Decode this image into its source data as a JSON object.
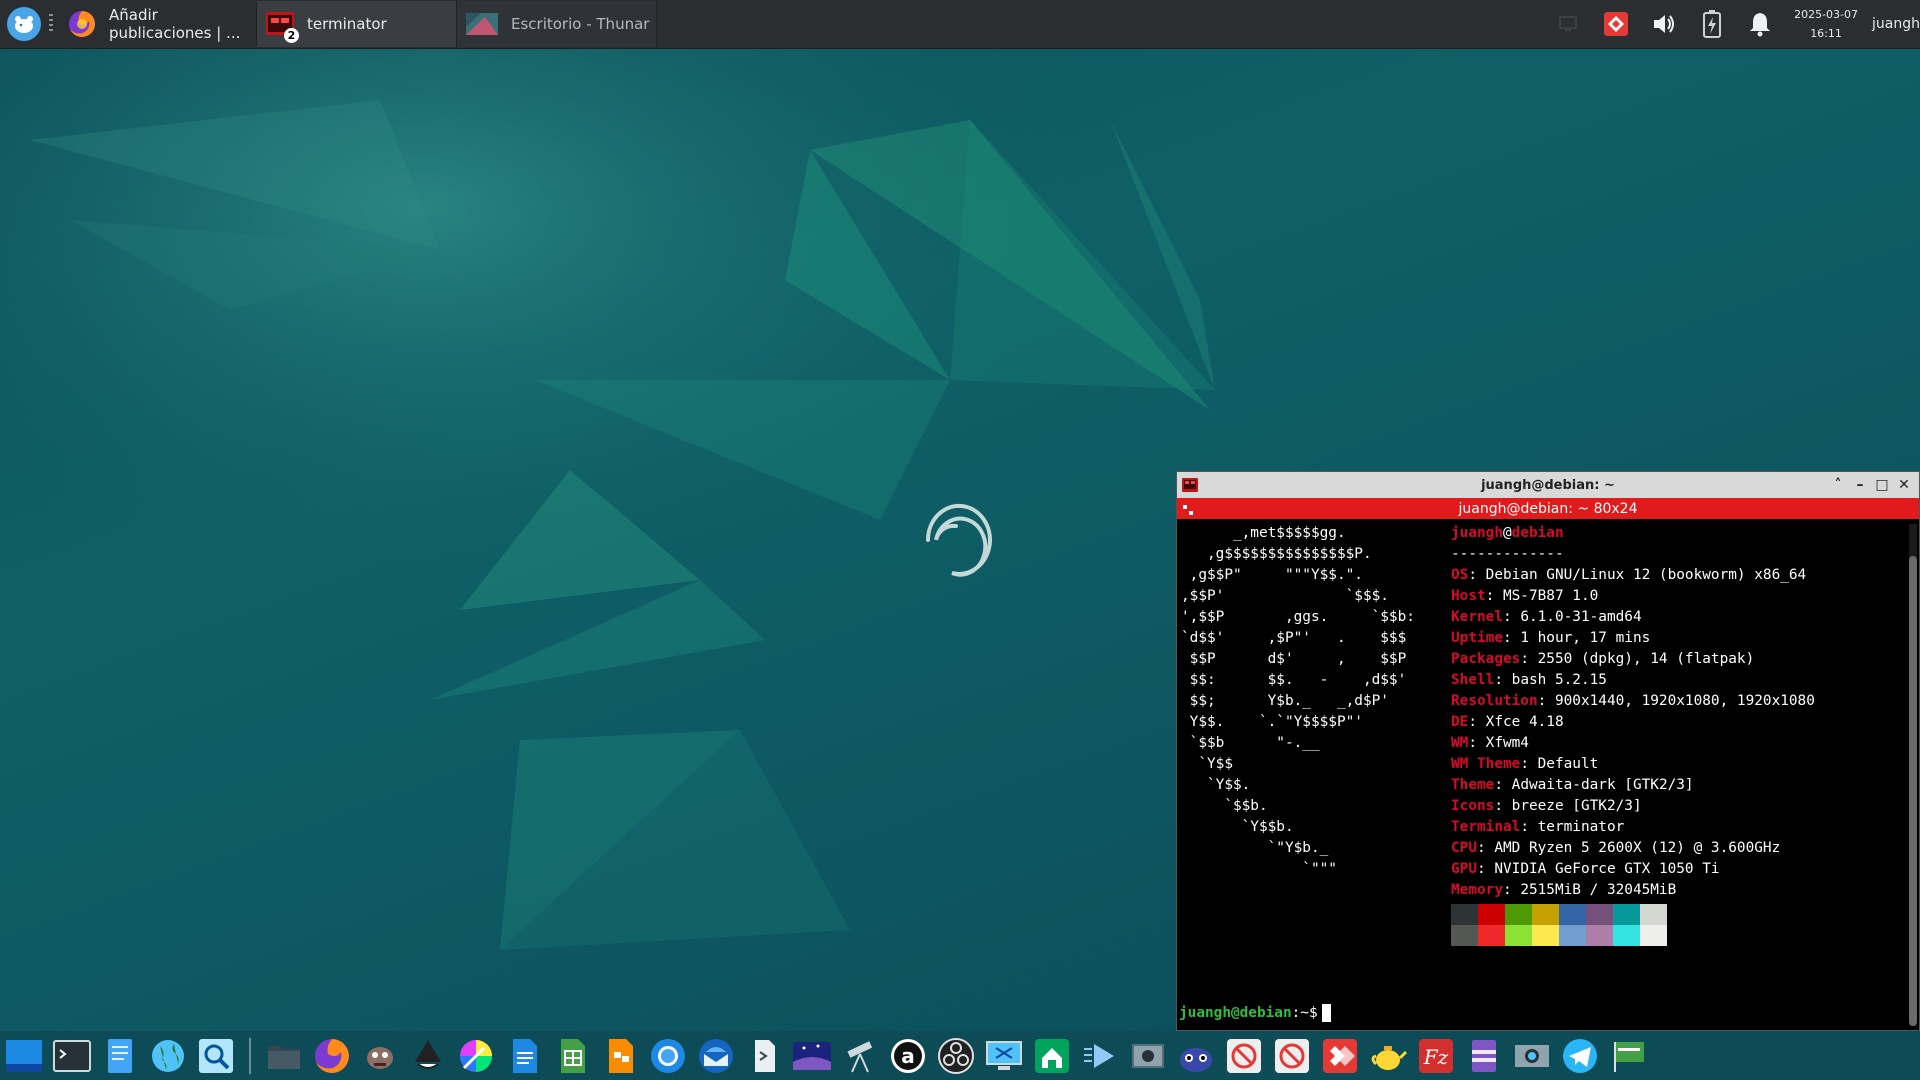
{
  "top_panel": {
    "tasks": [
      {
        "label": "Añadir publicaciones | ...",
        "icon": "firefox-icon",
        "state": "normal"
      },
      {
        "label": "terminator",
        "icon": "terminator-icon",
        "state": "active",
        "badge": "2"
      },
      {
        "label": "Escritorio - Thunar",
        "icon": "thunar-icon",
        "state": "inactive"
      }
    ],
    "clock": {
      "date": "2025-03-07",
      "time": "16:11"
    },
    "user": "juangh"
  },
  "terminal": {
    "window_title": "juangh@debian: ~",
    "tab_title": "juangh@debian: ~ 80x24",
    "logo_lines": [
      "      _,met$$$$$gg.",
      "   ,g$$$$$$$$$$$$$$$P.",
      " ,g$$P\"     \"\"\"Y$$.\".",
      ",$$P'              `$$$.",
      "',$$P       ,ggs.     `$$b:",
      "`d$$'     ,$P\"'   .    $$$",
      " $$P      d$'     ,    $$P",
      " $$:      $$.   -    ,d$$'",
      " $$;      Y$b._   _,d$P'",
      " Y$$.    `.`\"Y$$$$P\"'",
      " `$$b      \"-.__",
      "  `Y$$",
      "   `Y$$.",
      "     `$$b.",
      "       `Y$$b.",
      "          `\"Y$b._",
      "              `\"\"\""
    ],
    "header": {
      "user": "juangh",
      "at": "@",
      "host": "debian",
      "rule": "-------------"
    },
    "info": [
      {
        "key": "OS",
        "value": "Debian GNU/Linux 12 (bookworm) x86_64"
      },
      {
        "key": "Host",
        "value": "MS-7B87 1.0"
      },
      {
        "key": "Kernel",
        "value": "6.1.0-31-amd64"
      },
      {
        "key": "Uptime",
        "value": "1 hour, 17 mins"
      },
      {
        "key": "Packages",
        "value": "2550 (dpkg), 14 (flatpak)"
      },
      {
        "key": "Shell",
        "value": "bash 5.2.15"
      },
      {
        "key": "Resolution",
        "value": "900x1440, 1920x1080, 1920x1080"
      },
      {
        "key": "DE",
        "value": "Xfce 4.18"
      },
      {
        "key": "WM",
        "value": "Xfwm4"
      },
      {
        "key": "WM Theme",
        "value": "Default"
      },
      {
        "key": "Theme",
        "value": "Adwaita-dark [GTK2/3]"
      },
      {
        "key": "Icons",
        "value": "breeze [GTK2/3]"
      },
      {
        "key": "Terminal",
        "value": "terminator"
      },
      {
        "key": "CPU",
        "value": "AMD Ryzen 5 2600X (12) @ 3.600GHz"
      },
      {
        "key": "GPU",
        "value": "NVIDIA GeForce GTX 1050 Ti"
      },
      {
        "key": "Memory",
        "value": "2515MiB / 32045MiB"
      }
    ],
    "palette": [
      "#2e3436",
      "#cc0000",
      "#4e9a06",
      "#c4a000",
      "#3465a4",
      "#75507b",
      "#06989a",
      "#d3d7cf",
      "#555753",
      "#ef2929",
      "#8ae234",
      "#fce94f",
      "#729fcf",
      "#ad7fa8",
      "#34e2e2",
      "#eeeeec"
    ],
    "prompt": {
      "user_host": "juangh@debian",
      "rest": ":~$"
    }
  },
  "dock": {
    "items": [
      "show-desktop-icon",
      "terminal-icon",
      "text-editor-icon",
      "web-browser-icon",
      "app-finder-icon",
      "separator",
      "file-manager-icon",
      "firefox-icon",
      "gimp-icon",
      "inkscape-icon",
      "color-picker-icon",
      "writer-icon",
      "calc-icon",
      "impress-icon",
      "chromium-icon",
      "thunderbird-icon",
      "script-icon",
      "stellarium-icon",
      "telescope-icon",
      "audacity-icon",
      "obs-icon",
      "remote-desktop-icon",
      "house-icon",
      "media-player-icon",
      "video-editor-icon",
      "game-icon",
      "blocked-app-icon",
      "blocked-app-icon",
      "anydesk-icon",
      "teapot-icon",
      "filezilla-icon",
      "archive-icon",
      "screenshot-icon",
      "telegram-icon",
      "flag-app-icon"
    ]
  },
  "colors": {
    "panel": "#2b2e31",
    "accent_red": "#e11b1b",
    "debian_red": "#d70a2c",
    "desktop_teal": "#0f6066"
  }
}
